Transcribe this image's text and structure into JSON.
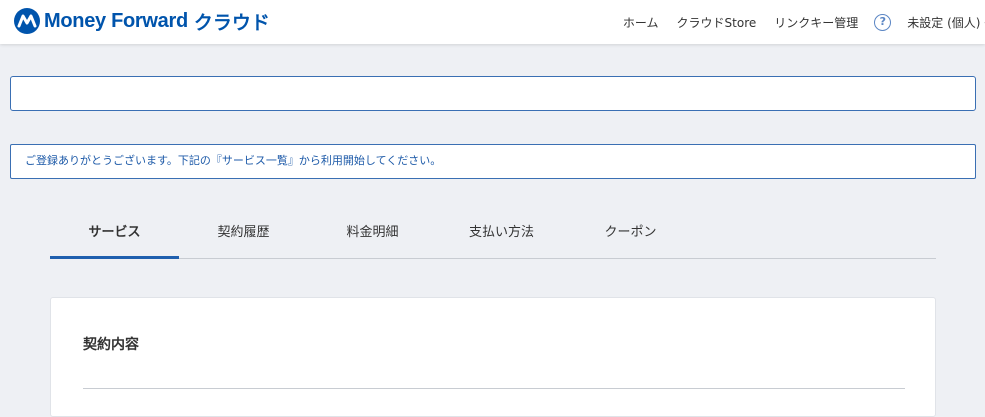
{
  "header": {
    "logo_text": "Money Forward",
    "logo_text_jp": "クラウド",
    "nav": [
      "ホーム",
      "クラウドStore",
      "リンクキー管理"
    ],
    "help_icon": "?",
    "user": "未設定 (個人)",
    "brand_color": "#0054ac"
  },
  "notice": {
    "message": "ご登録ありがとうございます。下記の『サービス一覧』から利用開始してください。"
  },
  "tabs": {
    "items": [
      "サービス",
      "契約履歴",
      "料金明細",
      "支払い方法",
      "クーポン"
    ],
    "active": "サービス"
  },
  "card": {
    "title": "契約内容"
  }
}
